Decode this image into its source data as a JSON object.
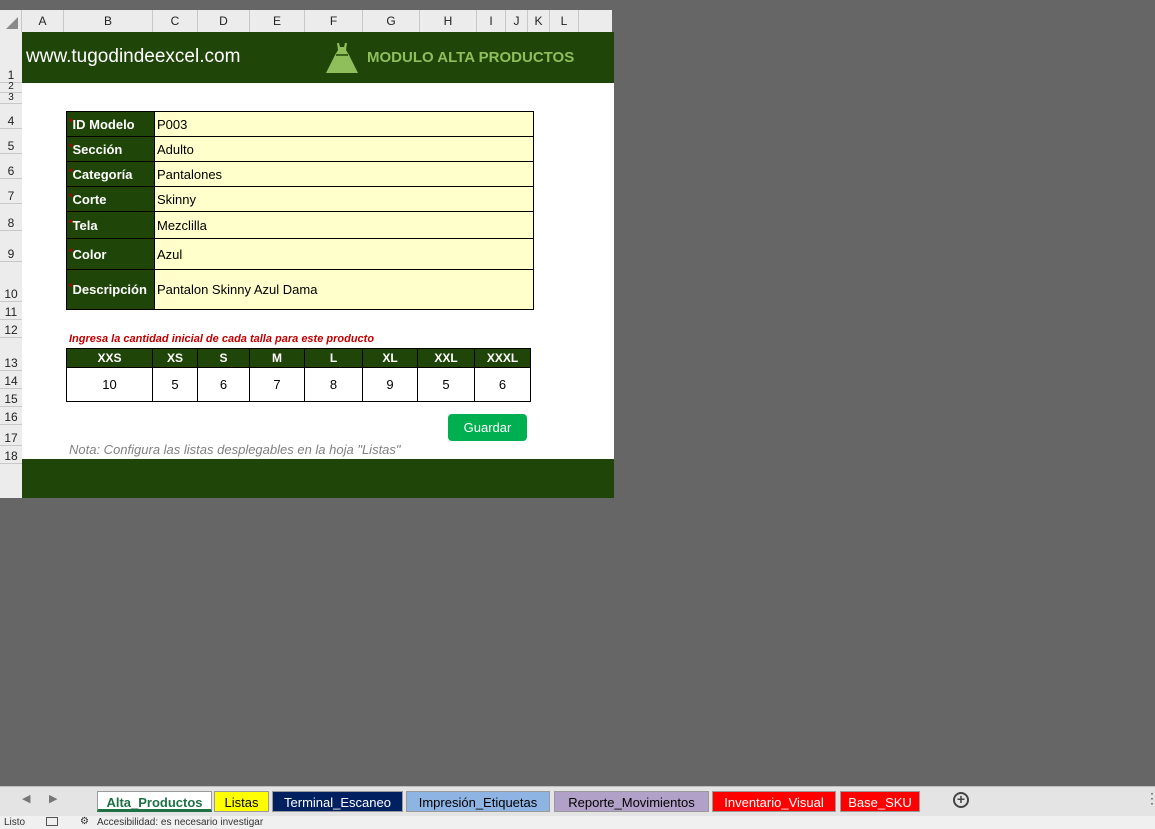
{
  "columns": [
    "A",
    "B",
    "C",
    "D",
    "E",
    "F",
    "G",
    "H",
    "I",
    "J",
    "K",
    "L"
  ],
  "rows": [
    "1",
    "2",
    "3",
    "4",
    "5",
    "6",
    "7",
    "8",
    "9",
    "10",
    "11",
    "12",
    "13",
    "14",
    "15",
    "16",
    "17",
    "18"
  ],
  "banner": {
    "site": "www.tugodindeexcel.com",
    "logo_icon": "dress-icon",
    "title": "MODULO ALTA PRODUCTOS"
  },
  "form": {
    "required_marker": "*",
    "fields": [
      {
        "label": "ID Modelo",
        "value": "P003"
      },
      {
        "label": "Sección",
        "value": "Adulto"
      },
      {
        "label": "Categoría",
        "value": "Pantalones"
      },
      {
        "label": "Corte",
        "value": "Skinny"
      },
      {
        "label": "Tela",
        "value": "Mezclilla"
      },
      {
        "label": "Color",
        "value": "Azul"
      },
      {
        "label": "Descripción",
        "value": "Pantalon Skinny Azul Dama"
      }
    ]
  },
  "sizes": {
    "hint": "Ingresa la cantidad inicial de cada talla para este producto",
    "headers": [
      "XXS",
      "XS",
      "S",
      "M",
      "L",
      "XL",
      "XXL",
      "XXXL"
    ],
    "values": [
      "10",
      "5",
      "6",
      "7",
      "8",
      "9",
      "5",
      "6"
    ]
  },
  "save_button": "Guardar",
  "note": "Nota: Configura las listas desplegables en la hoja \"Listas\"",
  "sheet_tabs": [
    {
      "label": "Alta_Productos",
      "bg": "#ffffff",
      "fg": "#1e7145",
      "active": true
    },
    {
      "label": "Listas",
      "bg": "#ffff00",
      "fg": "#000000"
    },
    {
      "label": "Terminal_Escaneo",
      "bg": "#002060",
      "fg": "#ffffff"
    },
    {
      "label": "Impresión_Etiquetas",
      "bg": "#8db4e2",
      "fg": "#000000"
    },
    {
      "label": "Reporte_Movimientos",
      "bg": "#b1a0c7",
      "fg": "#000000"
    },
    {
      "label": "Inventario_Visual",
      "bg": "#ff0000",
      "fg": "#ffffff"
    },
    {
      "label": "Base_SKU",
      "bg": "#ff0000",
      "fg": "#ffffff"
    }
  ],
  "status": {
    "ready": "Listo",
    "accessibility": "Accesibilidad: es necesario investigar"
  },
  "colors": {
    "banner_bg": "#1f4509",
    "title_fg": "#8fbf5a",
    "input_bg": "#ffffcc",
    "button_bg": "#00b050",
    "workspace_bg": "#666666"
  }
}
